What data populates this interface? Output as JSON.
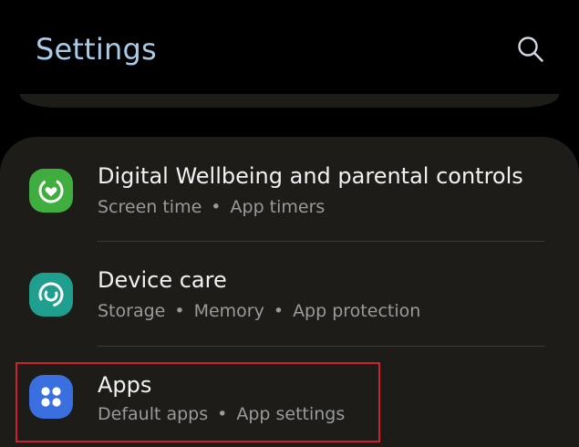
{
  "header": {
    "title": "Settings",
    "search_icon": "search-icon"
  },
  "items": [
    {
      "title": "Digital Wellbeing and parental controls",
      "subtitle": [
        "Screen time",
        "App timers"
      ],
      "icon": "digital-wellbeing-icon",
      "icon_color": "#3fae3f"
    },
    {
      "title": "Device care",
      "subtitle": [
        "Storage",
        "Memory",
        "App protection"
      ],
      "icon": "device-care-icon",
      "icon_color": "#1fa08e"
    },
    {
      "title": "Apps",
      "subtitle": [
        "Default apps",
        "App settings"
      ],
      "icon": "apps-icon",
      "icon_color": "#3a6fe0"
    }
  ],
  "separator": "•",
  "colors": {
    "background": "#000000",
    "card": "#1d1c19",
    "title": "#a9cbe6",
    "highlight": "#d0202b"
  }
}
